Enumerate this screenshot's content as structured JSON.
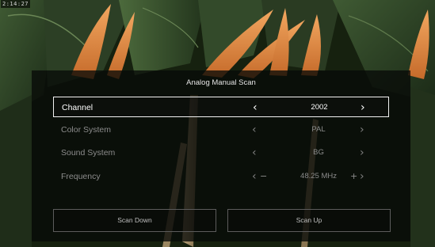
{
  "status": {
    "timestamp": "2:14:27"
  },
  "dialog": {
    "title": "Analog Manual Scan",
    "rows": [
      {
        "label": "Channel",
        "value": "2002",
        "focused": true
      },
      {
        "label": "Color System",
        "value": "PAL",
        "focused": false
      },
      {
        "label": "Sound System",
        "value": "BG",
        "focused": false
      },
      {
        "label": "Frequency",
        "value": "48.25 MHz",
        "focused": false,
        "minus": "−",
        "plus": "+"
      }
    ],
    "buttons": {
      "scan_down": "Scan Down",
      "scan_up": "Scan Up"
    }
  },
  "icons": {
    "left": "chevron-left-icon",
    "right": "chevron-right-icon"
  },
  "colors": {
    "focus_border": "#f2f2f2",
    "panel_bg": "#080a08",
    "dim_text": "#8c8c8c"
  }
}
